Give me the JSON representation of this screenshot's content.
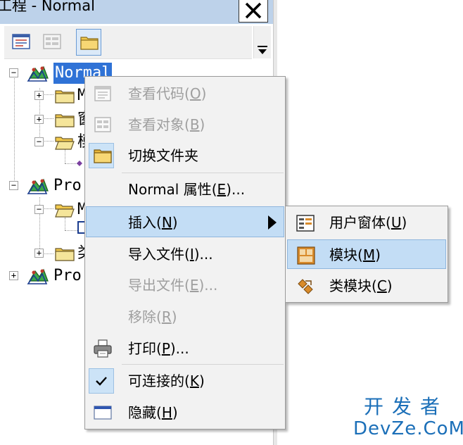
{
  "window": {
    "title": "工程 - Normal",
    "close_glyph": "✕"
  },
  "toolbar": {
    "buttons": [
      {
        "icon": "view-code-icon"
      },
      {
        "icon": "view-object-icon"
      },
      {
        "icon": "toggle-folders-icon",
        "active": true
      }
    ]
  },
  "tree": {
    "nodes": [
      {
        "label": "Normal",
        "selected": true
      },
      {
        "label": "M"
      },
      {
        "label": "窗"
      },
      {
        "label": "模"
      },
      {
        "label": "Pro"
      },
      {
        "label": "M"
      },
      {
        "label": "类"
      },
      {
        "label": "Pro"
      }
    ]
  },
  "context_menu": {
    "items": [
      {
        "pre": "查看代码(",
        "key": "O",
        "post": ")",
        "enabled": false
      },
      {
        "pre": "查看对象(",
        "key": "B",
        "post": ")",
        "enabled": false
      },
      {
        "pre": "切换文件夹",
        "key": "",
        "post": "",
        "enabled": true
      },
      {
        "pre": "Normal 属性(",
        "key": "E",
        "post": ")...",
        "enabled": true
      },
      {
        "pre": "插入(",
        "key": "N",
        "post": ")",
        "enabled": true,
        "highlighted": true,
        "has_submenu": true
      },
      {
        "pre": "导入文件(",
        "key": "I",
        "post": ")...",
        "enabled": true
      },
      {
        "pre": "导出文件(",
        "key": "E",
        "post": ")...",
        "enabled": false
      },
      {
        "pre": "移除(",
        "key": "R",
        "post": ")",
        "enabled": false
      },
      {
        "pre": "打印(",
        "key": "P",
        "post": ")...",
        "enabled": true
      },
      {
        "pre": "可连接的(",
        "key": "K",
        "post": ")",
        "enabled": true,
        "checked": true
      },
      {
        "pre": "隐藏(",
        "key": "H",
        "post": ")",
        "enabled": true
      }
    ]
  },
  "submenu": {
    "items": [
      {
        "pre": "用户窗体(",
        "key": "U",
        "post": ")"
      },
      {
        "pre": "模块(",
        "key": "M",
        "post": ")",
        "highlighted": true
      },
      {
        "pre": "类模块(",
        "key": "C",
        "post": ")"
      }
    ]
  },
  "watermark": {
    "cn": "开发者",
    "en": "DevZe.CoM"
  },
  "colors": {
    "title_bg": "#bdd2ea",
    "selection": "#2f72d6",
    "menu_highlight": "#c3ddf5",
    "watermark": "#1b6fb8"
  }
}
